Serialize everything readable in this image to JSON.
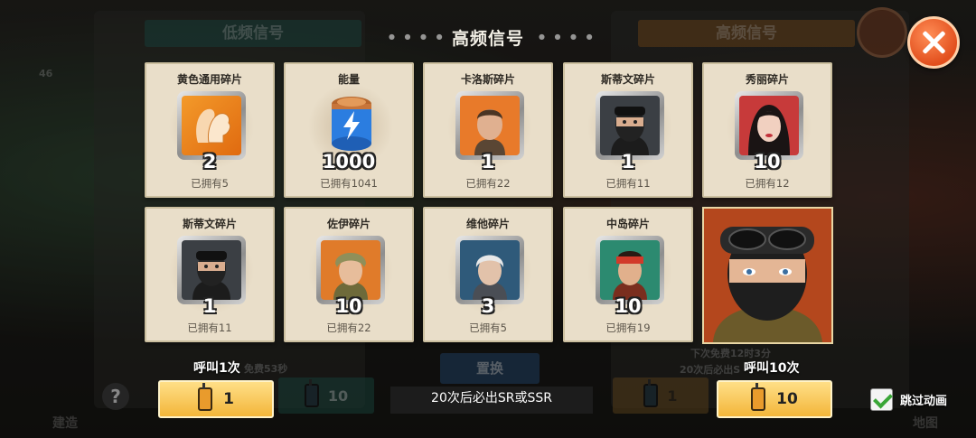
{
  "screen": {
    "title": "高频信号",
    "tabs": {
      "low": "低频信号",
      "high": "高频信号"
    }
  },
  "cards": [
    {
      "name": "黄色通用碎片",
      "qty": "2",
      "owned": "已拥有5",
      "icon": "universal-shard-icon"
    },
    {
      "name": "能量",
      "qty": "1000",
      "owned": "已拥有1041",
      "icon": "energy-battery-icon"
    },
    {
      "name": "卡洛斯碎片",
      "qty": "1",
      "owned": "已拥有22",
      "icon": "carlos-portrait"
    },
    {
      "name": "斯蒂文碎片",
      "qty": "1",
      "owned": "已拥有11",
      "icon": "steven-portrait"
    },
    {
      "name": "秀丽碎片",
      "qty": "10",
      "owned": "已拥有12",
      "icon": "xiuli-portrait"
    },
    {
      "name": "斯蒂文碎片",
      "qty": "1",
      "owned": "已拥有11",
      "icon": "steven-portrait"
    },
    {
      "name": "佐伊碎片",
      "qty": "10",
      "owned": "已拥有22",
      "icon": "zoey-portrait"
    },
    {
      "name": "维他碎片",
      "qty": "3",
      "owned": "已拥有5",
      "icon": "vita-portrait"
    },
    {
      "name": "中岛碎片",
      "qty": "10",
      "owned": "已拥有19",
      "icon": "nakajima-portrait"
    }
  ],
  "featured": {
    "icon": "steven-large-portrait"
  },
  "actions": {
    "call_once_label": "呼叫1次",
    "call_once_cost": "1",
    "call_ten_label": "呼叫10次",
    "call_ten_cost": "10",
    "guarantee": "20次后必出SR或SSR",
    "skip_animation": "跳过动画",
    "skip_checked": true
  },
  "background": {
    "left_timer": "免费53秒",
    "right_timer": "下次免费12时3分",
    "right_guarantee": "20次后必出S",
    "swap_label": "置换",
    "left_ghost_cost": "10",
    "right_ghost_cost": "1",
    "left_corner": "建造",
    "right_corner": "地图",
    "level_badge": "46"
  },
  "colors": {
    "card_bg": "#e9dec9",
    "button_gold": "#f3b63a",
    "close_orange": "#e24f1d",
    "check_green": "#3aa637"
  }
}
